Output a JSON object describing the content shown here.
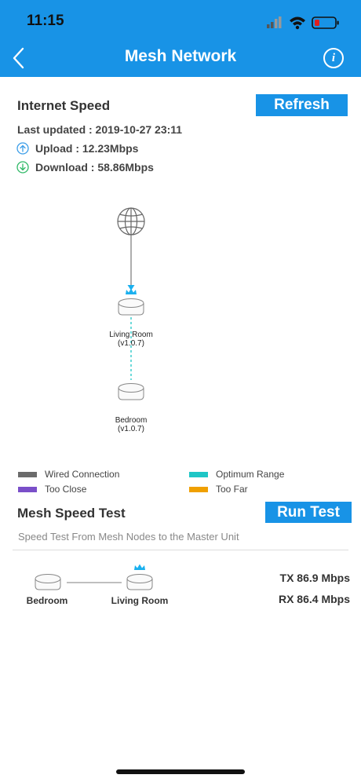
{
  "status": {
    "time": "11:15"
  },
  "nav": {
    "title": "Mesh Network"
  },
  "internet": {
    "title": "Internet Speed",
    "refresh_label": "Refresh",
    "last_updated": "Last updated : 2019-10-27 23:11",
    "upload": "Upload : 12.23Mbps",
    "download": "Download : 58.86Mbps"
  },
  "topology": {
    "nodes": [
      {
        "name": "Living Room",
        "version": "(v1.0.7)"
      },
      {
        "name": "Bedroom",
        "version": "(v1.0.7)"
      }
    ]
  },
  "legend": {
    "items": [
      {
        "label": "Wired Connection",
        "color": "#6b6b6b"
      },
      {
        "label": "Optimum Range",
        "color": "#1fc6c6"
      },
      {
        "label": "Too Close",
        "color": "#7a4fc9"
      },
      {
        "label": "Too Far",
        "color": "#f0a000"
      }
    ]
  },
  "mesh_test": {
    "title": "Mesh Speed Test",
    "run_label": "Run Test",
    "subtitle": "Speed Test From Mesh Nodes to the Master Unit",
    "from_node": "Bedroom",
    "to_node": "Living Room",
    "tx": "TX 86.9 Mbps",
    "rx": "RX 86.4 Mbps"
  },
  "colors": {
    "accent": "#1893e6",
    "upload": "#3a9de8",
    "download": "#2fb866",
    "crown": "#1ab0ef"
  }
}
